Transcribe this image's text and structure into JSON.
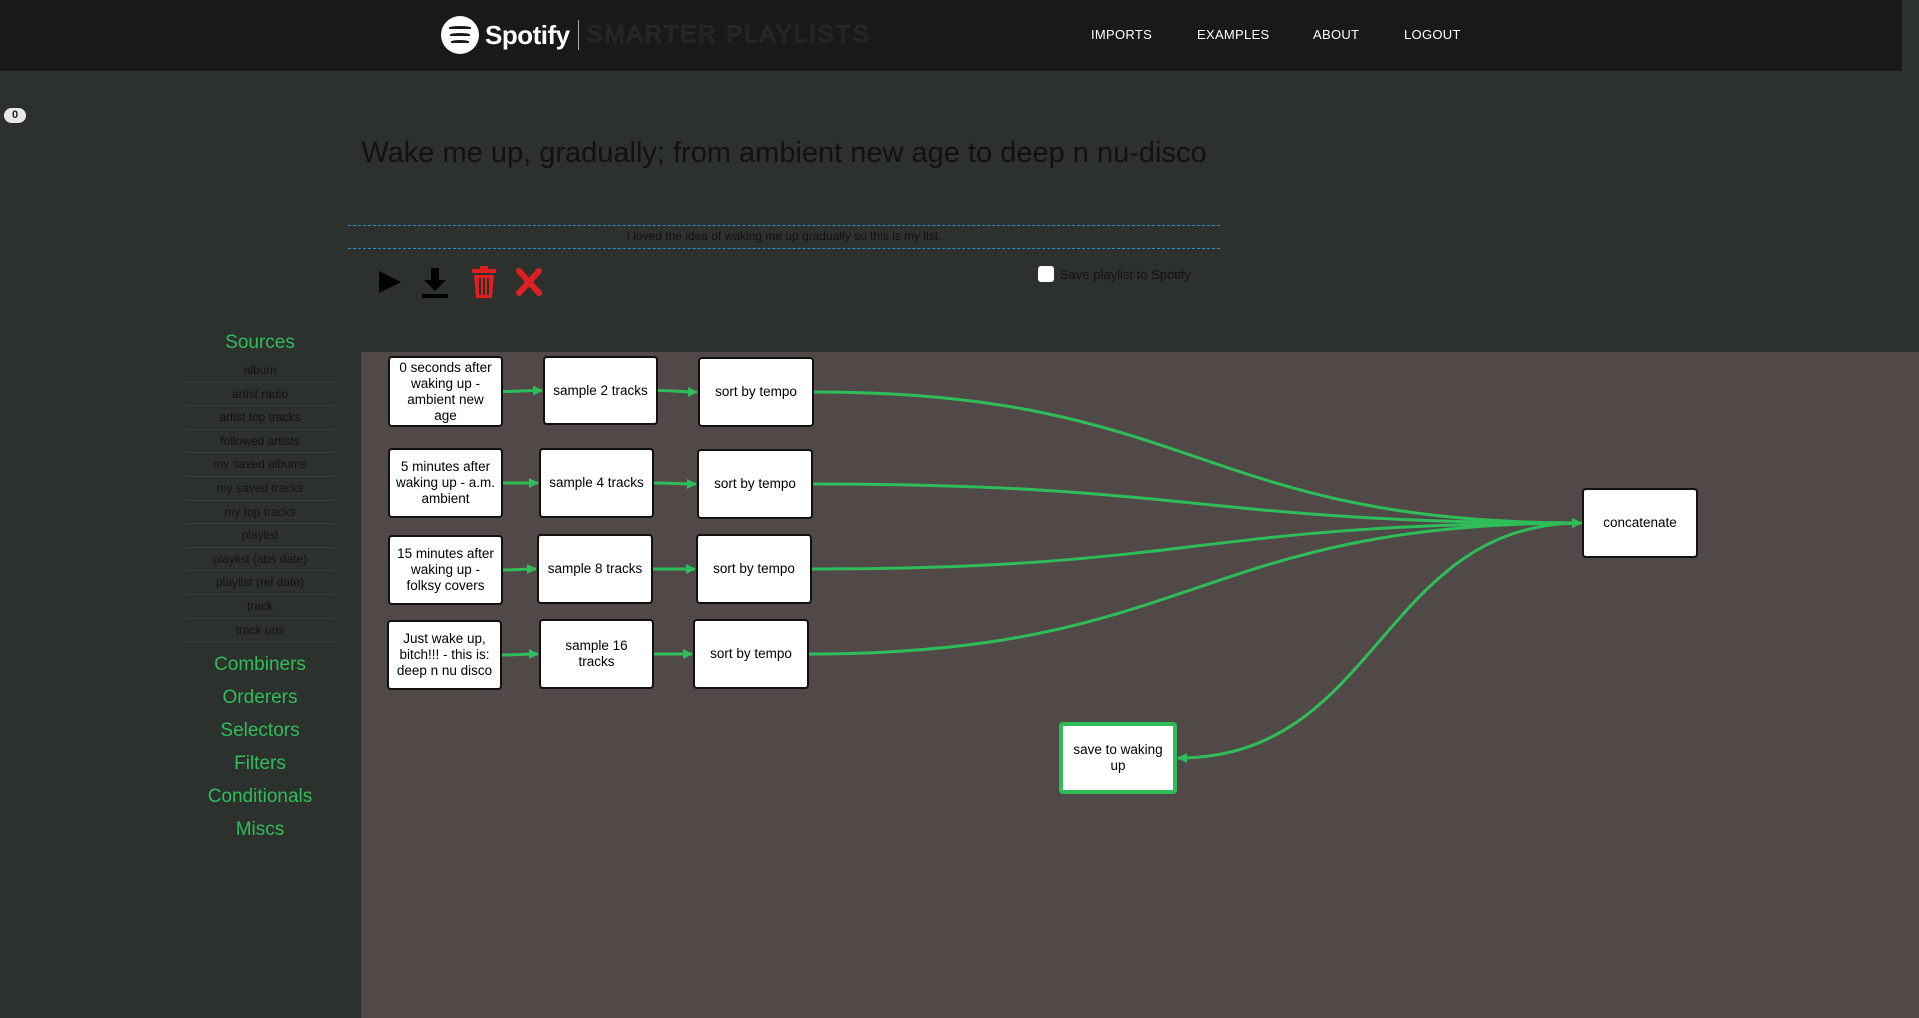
{
  "brand": {
    "name": "Spotify",
    "subtitle": "SMARTER PLAYLISTS"
  },
  "nav": [
    "IMPORTS",
    "EXAMPLES",
    "ABOUT",
    "LOGOUT"
  ],
  "counter": "0",
  "program": {
    "title": "Wake me up, gradually; from ambient new age to deep n nu-disco",
    "description": "I loved the idea of waking me up gradually so this is my list."
  },
  "toolbar": {
    "icons": [
      "play-icon",
      "download-icon",
      "trash-icon",
      "close-icon"
    ],
    "save_label": "Save playlist to Spotify"
  },
  "sidebar": {
    "sources_title": "Sources",
    "sources": [
      "album",
      "artist radio",
      "artist top tracks",
      "followed artists",
      "my saved albums",
      "my saved tracks",
      "my top tracks",
      "playlist",
      "playlist (abs date)",
      "playlist (rel date)",
      "track",
      "track uris"
    ],
    "categories": [
      "Combiners",
      "Orderers",
      "Selectors",
      "Filters",
      "Conditionals",
      "Miscs"
    ]
  },
  "graph": {
    "nodes": [
      {
        "id": "s1",
        "label": "0 seconds after waking up - ambient new age"
      },
      {
        "id": "p1",
        "label": "sample 2 tracks"
      },
      {
        "id": "o1",
        "label": "sort by tempo"
      },
      {
        "id": "s2",
        "label": "5 minutes after waking up - a.m. ambient"
      },
      {
        "id": "p2",
        "label": "sample 4 tracks"
      },
      {
        "id": "o2",
        "label": "sort by tempo"
      },
      {
        "id": "s3",
        "label": "15 minutes after waking up - folksy covers"
      },
      {
        "id": "p3",
        "label": "sample 8 tracks"
      },
      {
        "id": "o3",
        "label": "sort by tempo"
      },
      {
        "id": "s4",
        "label": "Just wake up, bitch!!! - this is: deep n nu disco"
      },
      {
        "id": "p4",
        "label": "sample 16 tracks"
      },
      {
        "id": "o4",
        "label": "sort by tempo"
      },
      {
        "id": "cat",
        "label": "concatenate"
      },
      {
        "id": "save",
        "label": "save to waking up",
        "active": true
      }
    ],
    "edges": [
      [
        "s1",
        "p1"
      ],
      [
        "p1",
        "o1"
      ],
      [
        "o1",
        "cat"
      ],
      [
        "s2",
        "p2"
      ],
      [
        "p2",
        "o2"
      ],
      [
        "o2",
        "cat"
      ],
      [
        "s3",
        "p3"
      ],
      [
        "p3",
        "o3"
      ],
      [
        "o3",
        "cat"
      ],
      [
        "s4",
        "p4"
      ],
      [
        "p4",
        "o4"
      ],
      [
        "o4",
        "cat"
      ],
      [
        "cat",
        "save"
      ]
    ],
    "edge_color": "#2ebd59"
  },
  "colors": {
    "accent": "#2ebd59",
    "danger": "#e02020"
  }
}
